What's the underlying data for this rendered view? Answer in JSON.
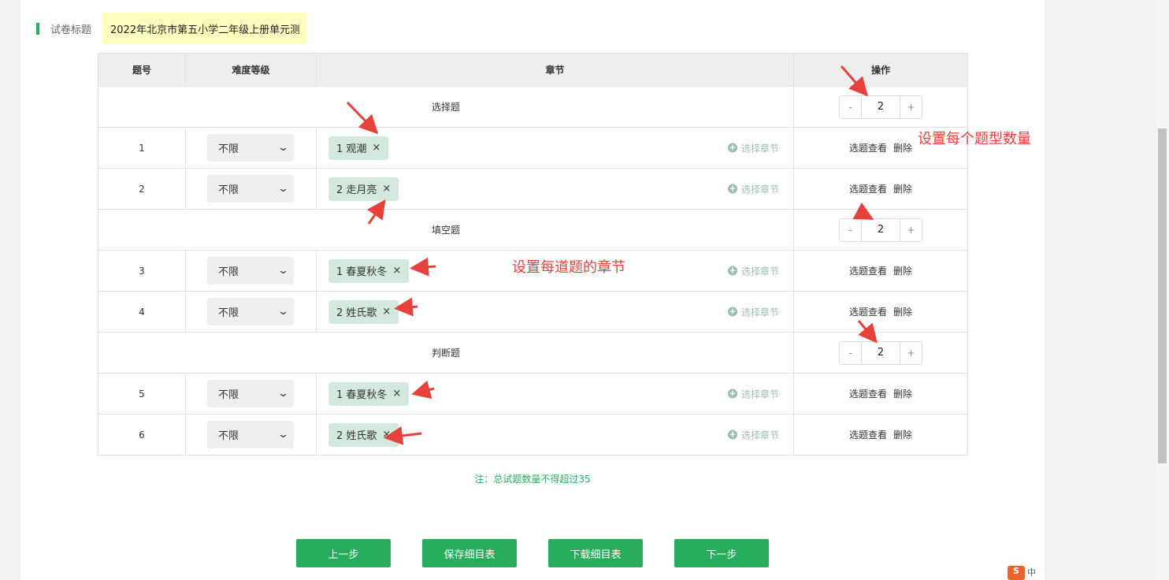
{
  "form": {
    "title_label": "试卷标题",
    "title_value": "2022年北京市第五小学二年级上册单元测"
  },
  "table": {
    "headers": {
      "num": "题号",
      "difficulty": "难度等级",
      "chapter": "章节",
      "ops": "操作"
    },
    "choose_chapter_label": "选择章节",
    "view_label": "选题查看",
    "delete_label": "删除",
    "sections": [
      {
        "name": "选择题",
        "count": "2",
        "minus": "-",
        "plus": "+",
        "rows": [
          {
            "num": "1",
            "difficulty": "不限",
            "tag": "1 观潮"
          },
          {
            "num": "2",
            "difficulty": "不限",
            "tag": "2 走月亮"
          }
        ]
      },
      {
        "name": "填空题",
        "count": "2",
        "minus": "-",
        "plus": "+",
        "rows": [
          {
            "num": "3",
            "difficulty": "不限",
            "tag": "1 春夏秋冬"
          },
          {
            "num": "4",
            "difficulty": "不限",
            "tag": "2 姓氏歌"
          }
        ]
      },
      {
        "name": "判断题",
        "count": "2",
        "minus": "-",
        "plus": "+",
        "rows": [
          {
            "num": "5",
            "difficulty": "不限",
            "tag": "1 春夏秋冬"
          },
          {
            "num": "6",
            "difficulty": "不限",
            "tag": "2 姓氏歌"
          }
        ]
      }
    ]
  },
  "note": "注：总试题数量不得超过35",
  "buttons": {
    "prev": "上一步",
    "save": "保存细目表",
    "download": "下载细目表",
    "next": "下一步"
  },
  "annotations": {
    "type_count": "设置每个题型数量",
    "chapter": "设置每道题的章节"
  },
  "tray": {
    "ime": "S",
    "lang": "中"
  },
  "colors": {
    "accent": "#28ad5c",
    "annotation": "#e8403b",
    "title_bg": "#ffffc0",
    "tag_bg": "#d4e9de"
  }
}
